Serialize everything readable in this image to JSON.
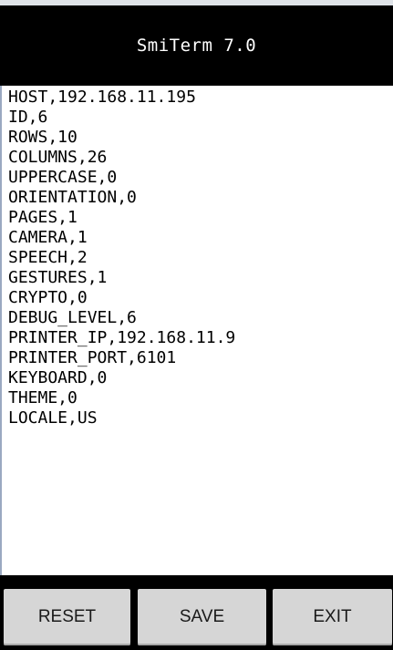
{
  "app": {
    "title": "SmiTerm 7.0"
  },
  "config": {
    "lines": [
      "HOST,192.168.11.195",
      "ID,6",
      "ROWS,10",
      "COLUMNS,26",
      "UPPERCASE,0",
      "ORIENTATION,0",
      "PAGES,1",
      "CAMERA,1",
      "SPEECH,2",
      "GESTURES,1",
      "CRYPTO,0",
      "DEBUG_LEVEL,6",
      "PRINTER_IP,192.168.11.9",
      "PRINTER_PORT,6101",
      "KEYBOARD,0",
      "THEME,0",
      "LOCALE,US"
    ]
  },
  "buttons": {
    "reset_label": "RESET",
    "save_label": "SAVE",
    "exit_label": "EXIT"
  },
  "colors": {
    "title_bar_background": "#000000",
    "title_text": "#ffffff",
    "editor_background": "#ffffff",
    "button_background": "#d6d6d6"
  }
}
